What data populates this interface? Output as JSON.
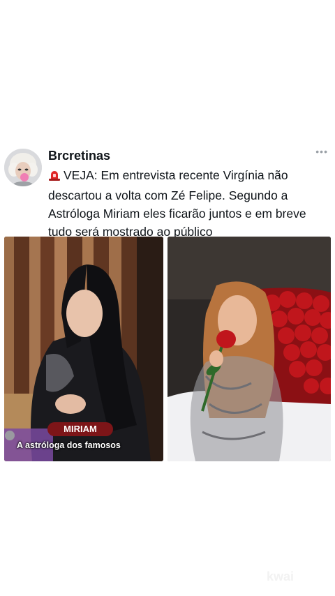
{
  "post": {
    "username": "Brcretinas",
    "more_label": "•••",
    "body": "VEJA: Em entrevista recente Virgínia não descartou a volta com Zé Felipe. Segundo a Astróloga Miriam eles ficarão juntos e em breve tudo será mostrado ao público",
    "photo_left": {
      "name_badge": "MIRIAM",
      "caption": "A astróloga dos famosos"
    }
  },
  "icons": {
    "siren": "police-light-icon",
    "more": "more-options-icon"
  },
  "watermark": "kwai",
  "colors": {
    "badge": "#7d1518",
    "text": "#0f1419",
    "rose": "#c0161c"
  }
}
